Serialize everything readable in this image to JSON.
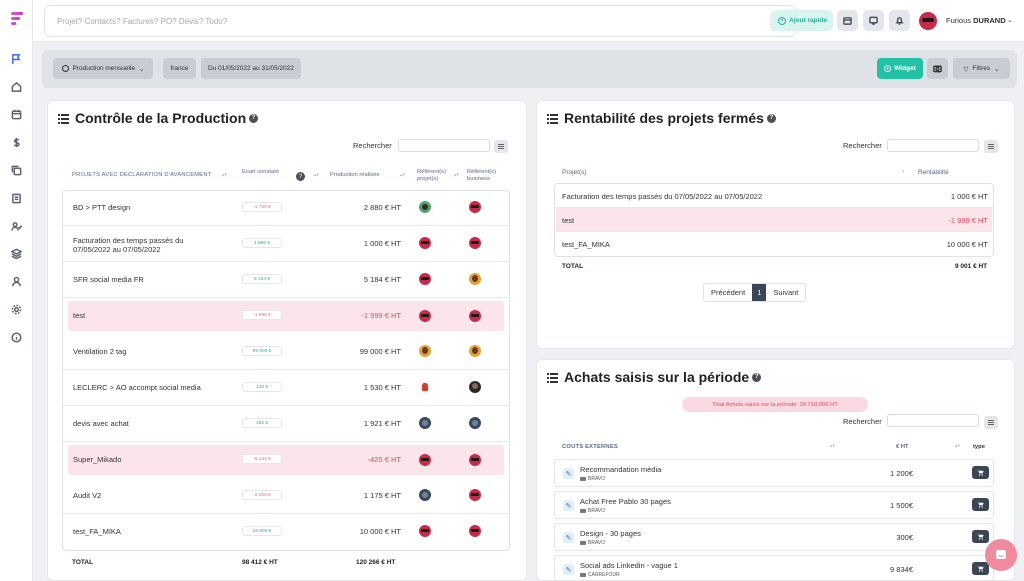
{
  "topbar": {
    "search_placeholder": "Projet? Contacts? Factures? PO? Devis? Todo?",
    "quick_add_label": "Ajout rapide",
    "user_first": "Furious",
    "user_last": "DURAND"
  },
  "filters": {
    "view_label": "Production mensuelle",
    "country": "france",
    "period": "Du 01/05/2022 au 31/05/2022",
    "widget_label": "Widget",
    "filters_label": "Filtres"
  },
  "colors": {
    "accent_teal": "#22c3a5",
    "danger": "#ef4a5c",
    "highlight_row": "#fbe4ea"
  },
  "production": {
    "title": "Contrôle de la Production",
    "search_label": "Rechercher",
    "columns": {
      "project": "PROJETS AVEC DECLARATION D'AVANCEMENT",
      "gap": "Ecart constaté",
      "production": "Production réalisée",
      "ref_project": "Référent(s) projet(s)",
      "ref_business": "Référent(s) business"
    },
    "rows": [
      {
        "name": "BD > PTT design",
        "gap": "-1 720 €",
        "amount": "2 880 € HT",
        "highlight": false
      },
      {
        "name": "Facturation des temps passés du 07/05/2022 au 07/05/2022",
        "gap": "1 000 €",
        "amount": "1 000 € HT",
        "highlight": false
      },
      {
        "name": "SFR social media FR",
        "gap": "5 184 €",
        "amount": "5 184 € HT",
        "highlight": false
      },
      {
        "name": "test",
        "gap": "-1 999 €",
        "amount": "-1 999 € HT",
        "highlight": true
      },
      {
        "name": "Ventilation 2 tag",
        "gap": "99 000 €",
        "amount": "99 000 € HT",
        "highlight": false
      },
      {
        "name": "LECLERC > AO accompt social media",
        "gap": "130 €",
        "amount": "1 530 € HT",
        "highlight": false
      },
      {
        "name": "devis avec achat",
        "gap": "180 €",
        "amount": "1 921 € HT",
        "highlight": false
      },
      {
        "name": "Super_Mikado",
        "gap": "-6 144 €",
        "amount": "-425 € HT",
        "highlight": true
      },
      {
        "name": "Audit V2",
        "gap": "-2 200 €",
        "amount": "1 175 € HT",
        "highlight": false
      },
      {
        "name": "test_FA_MIKA",
        "gap": "10 000 €",
        "amount": "10 000 € HT",
        "highlight": false
      }
    ],
    "total_label": "TOTAL",
    "total_gap": "98 412 € HT",
    "total_production": "120 266 € HT"
  },
  "rentabilite": {
    "title": "Rentabilité des projets fermés",
    "search_label": "Rechercher",
    "columns": {
      "project": "Projet(s)",
      "value": "Rentabilité"
    },
    "rows": [
      {
        "name": "Facturation des temps passés du 07/05/2022 au 07/05/2022",
        "value": "1 000 € HT"
      },
      {
        "name": "test",
        "value": "-1 999 € HT"
      },
      {
        "name": "test_FA_MIKA",
        "value": "10 000 € HT"
      }
    ],
    "total_label": "TOTAL",
    "total_value": "9 001 € HT",
    "pager": {
      "prev": "Précédent",
      "page": "1",
      "next": "Suivant"
    }
  },
  "achats": {
    "title": "Achats saisis sur la période",
    "total_pill": "Total Achats saisis sur la période: 39 710,00€ HT",
    "search_label": "Rechercher",
    "columns": {
      "name": "COUTS EXTERNES",
      "ht": "€ HT",
      "type": "type"
    },
    "rows": [
      {
        "name": "Recommandation média",
        "supplier": "BRAVO",
        "ht": "1 200€"
      },
      {
        "name": "Achat Free Pablo 30 pages",
        "supplier": "BRAVO",
        "ht": "1 500€"
      },
      {
        "name": "Design - 30 pages",
        "supplier": "BRAVO",
        "ht": "300€"
      },
      {
        "name": "Social ads Linkedin - vague 1",
        "supplier": "CARREFOUR",
        "ht": "9 834€"
      }
    ]
  },
  "icons": {
    "rail": [
      "flag-icon",
      "home-icon",
      "calendar-icon",
      "dollar-icon",
      "copy-icon",
      "file-icon",
      "users-icon",
      "layers-icon",
      "user-icon",
      "settings-icon",
      "info-icon"
    ]
  }
}
